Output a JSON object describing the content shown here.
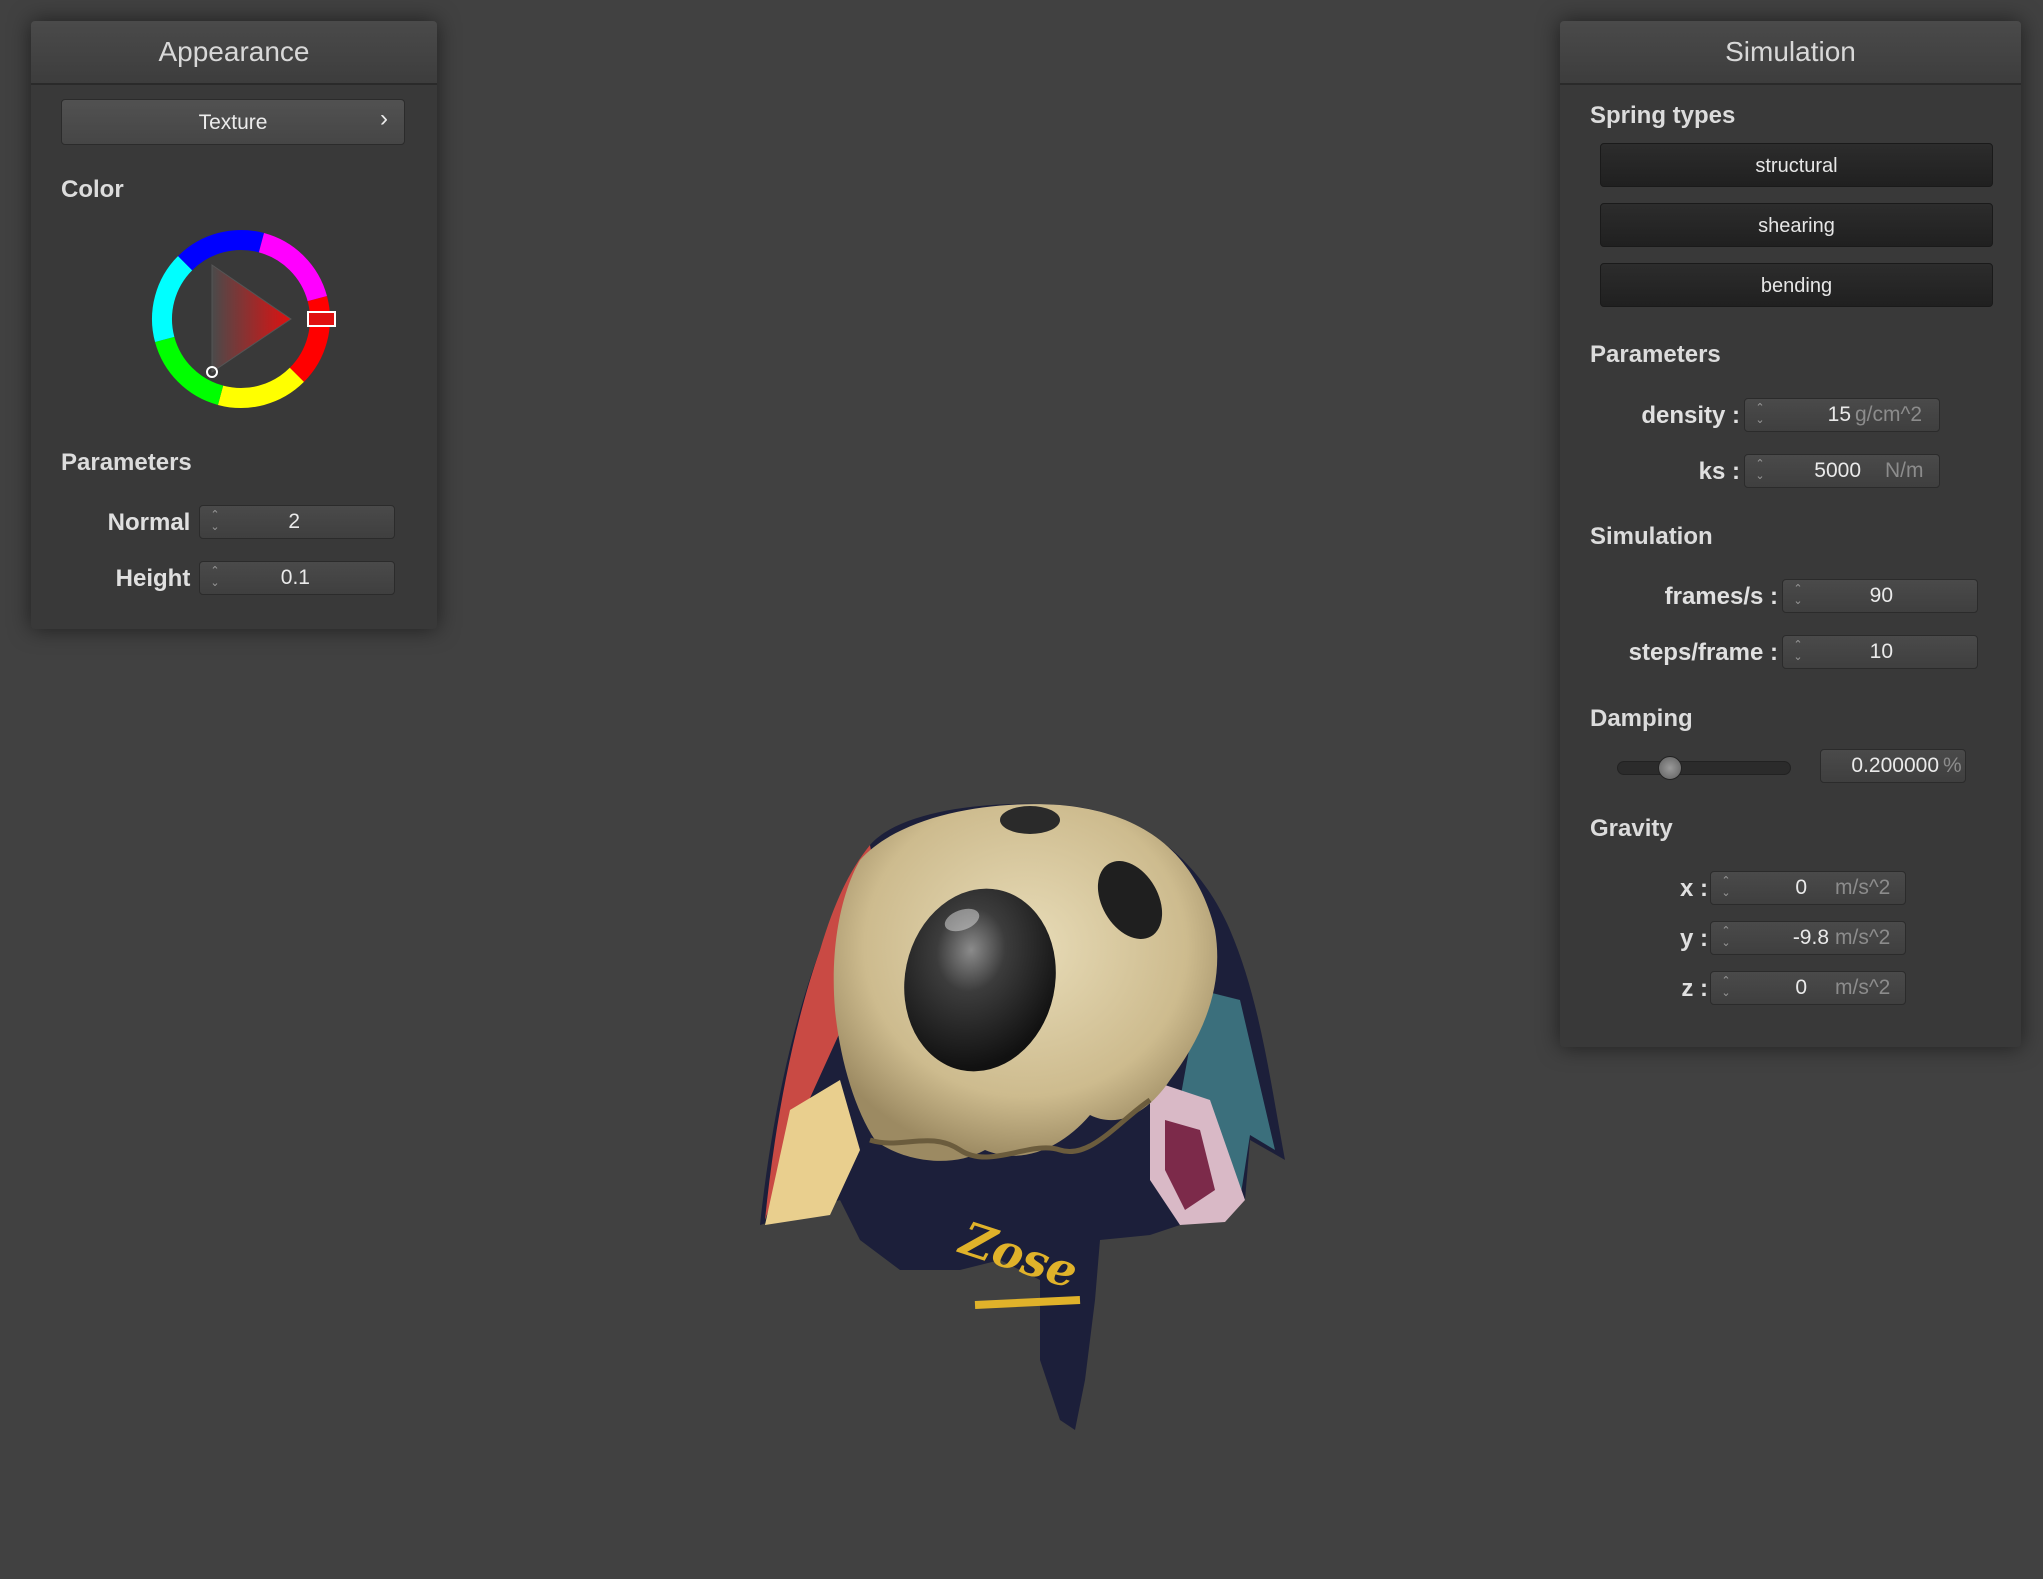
{
  "appearance": {
    "title": "Appearance",
    "texture_button": "Texture",
    "texture_chevron": "›",
    "color_title": "Color",
    "parameters_title": "Parameters",
    "normal_label": "Normal :",
    "normal_value": "2",
    "height_label": "Height :",
    "height_value": "0.1",
    "selected_color": "#ff0000"
  },
  "simulation": {
    "title": "Simulation",
    "spring_types_title": "Spring types",
    "spring_buttons": [
      "structural",
      "shearing",
      "bending"
    ],
    "parameters_title": "Parameters",
    "density_label": "density :",
    "density_value": "15",
    "density_unit": "g/cm^2",
    "ks_label": "ks :",
    "ks_value": "5000",
    "ks_unit": "N/m",
    "simulation_title": "Simulation",
    "fps_label": "frames/s :",
    "fps_value": "90",
    "steps_label": "steps/frame :",
    "steps_value": "10",
    "damping_title": "Damping",
    "damping_value": "0.200000",
    "damping_unit": "%",
    "damping_fraction": 0.2,
    "gravity_title": "Gravity",
    "gravity": [
      {
        "label": "x :",
        "value": "0",
        "unit": "m/s^2"
      },
      {
        "label": "y :",
        "value": "-9.8",
        "unit": "m/s^2"
      },
      {
        "label": "z :",
        "value": "0",
        "unit": "m/s^2"
      }
    ]
  },
  "viewport": {
    "cloth_text": "Zose"
  }
}
